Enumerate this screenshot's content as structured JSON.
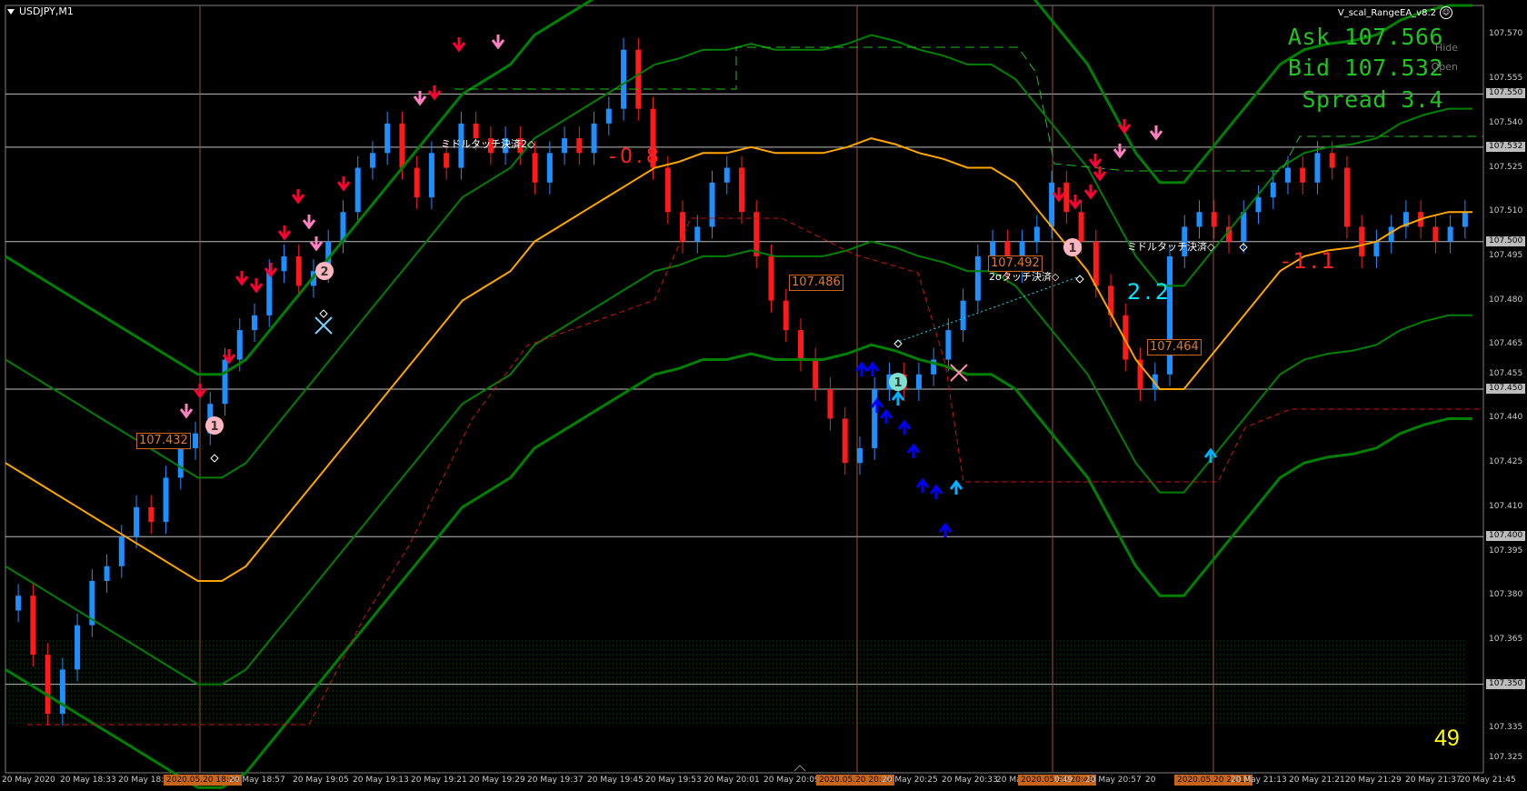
{
  "window": {
    "symbol": "USDJPY,M1",
    "ea_name": "V_scal_RangeEA_v8.2",
    "ea_icon": "smiley-face-icon"
  },
  "quote_panel": {
    "ask": "Ask 107.566",
    "bid": "Bid 107.532",
    "spread": "Spread 3.4",
    "hide_label": "Hide",
    "open_label": "Open",
    "text_color": "#1fc41f"
  },
  "tick_counter": "49",
  "price_axis": {
    "min": 107.32,
    "max": 107.58,
    "labels": [
      "107.570",
      "107.555",
      "107.540",
      "107.525",
      "107.510",
      "107.495",
      "107.480",
      "107.465",
      "107.455",
      "107.440",
      "107.425",
      "107.410",
      "107.395",
      "107.380",
      "107.365",
      "107.335",
      "107.325"
    ],
    "highlighted": [
      "107.550",
      "107.532",
      "107.500",
      "107.450",
      "107.400",
      "107.350"
    ]
  },
  "time_axis": {
    "labels": [
      "20 May 2020",
      "20 May 18:33",
      "20 May 18:",
      "2020.05.20 18:53",
      "20 May 18:57",
      "20 May 19:05",
      "20 May 19:13",
      "20 May 19:21",
      "20 May 19:29",
      "20 May 19:37",
      "20 May 19:45",
      "20 May 19:53",
      "20 May 20:01",
      "20 May 20:09",
      "2020.05.20 20:22",
      "20 May 20:25",
      "20 May 20:33",
      "20 May 20 Ma",
      "2020.05.20 20:49",
      "0:49",
      "20 May 20:57",
      "20",
      "2020.05.20 21:11",
      "20 May 21:13",
      "20 May 21:21",
      "20 May 21:29",
      "20 May 21:37",
      "20 May 21:45"
    ],
    "highlighted": [
      "2020.05.20 18:53",
      "2020.05.20 20:22",
      "2020.05.20 20:49",
      "2020.05.20 21:11"
    ]
  },
  "annotations": {
    "midtouch_1": "ミドルタッチ決済2◇",
    "midtouch_2": "ミドルタッチ決済◇",
    "sigma_touch": "2σタッチ決済◇",
    "price_box_1": "107.432",
    "price_box_2": "107.486",
    "price_box_3": "107.492",
    "price_box_4": "107.464",
    "profit_1": "2.2",
    "profit_2": "-1.1",
    "profit_3": "-0.8",
    "marker_1": "1",
    "marker_2": "2",
    "marker_3": "1",
    "marker_4": "1"
  },
  "colors": {
    "bull_candle": "#1e8fff",
    "bear_candle": "#ff1a1a",
    "middle_band": "#ffa500",
    "bollinger": "#008000",
    "sell_arrow": "#ff0033",
    "sell_arrow_light": "#ff80c0",
    "buy_arrow": "#0000ff",
    "buy_arrow_light": "#00b0ff",
    "vline": "#a0522d",
    "hline": "#bdbdbd"
  },
  "chart_data": {
    "type": "candlestick",
    "symbol": "USDJPY",
    "timeframe": "M1",
    "ylim": [
      107.32,
      107.58
    ],
    "hlines": [
      107.55,
      107.532,
      107.5,
      107.45,
      107.4,
      107.35
    ],
    "vline_times": [
      "18:53",
      "20:22",
      "20:49",
      "21:11"
    ],
    "close_path": [
      107.38,
      107.36,
      107.34,
      107.355,
      107.37,
      107.385,
      107.39,
      107.4,
      107.41,
      107.405,
      107.42,
      107.43,
      107.435,
      107.445,
      107.46,
      107.47,
      107.475,
      107.49,
      107.495,
      107.485,
      107.49,
      107.5,
      107.51,
      107.525,
      107.53,
      107.54,
      107.525,
      107.515,
      107.53,
      107.525,
      107.54,
      107.535,
      107.53,
      107.535,
      107.53,
      107.52,
      107.53,
      107.535,
      107.53,
      107.54,
      107.545,
      107.565,
      107.545,
      107.525,
      107.51,
      107.5,
      107.505,
      107.52,
      107.525,
      107.51,
      107.495,
      107.48,
      107.47,
      107.46,
      107.45,
      107.44,
      107.425,
      107.43,
      107.45,
      107.455,
      107.45,
      107.455,
      107.46,
      107.47,
      107.48,
      107.495,
      107.5,
      107.49,
      107.5,
      107.505,
      107.52,
      107.51,
      107.5,
      107.485,
      107.475,
      107.46,
      107.45,
      107.455,
      107.495,
      107.505,
      107.51,
      107.505,
      107.5,
      107.51,
      107.515,
      107.52,
      107.525,
      107.52,
      107.53,
      107.525,
      107.505,
      107.495,
      107.5,
      107.505,
      107.51,
      107.505,
      107.5,
      107.505,
      107.51
    ],
    "middle_band": [
      107.425,
      107.42,
      107.415,
      107.41,
      107.405,
      107.4,
      107.395,
      107.39,
      107.385,
      107.385,
      107.39,
      107.4,
      107.41,
      107.42,
      107.43,
      107.44,
      107.45,
      107.46,
      107.47,
      107.48,
      107.485,
      107.49,
      107.5,
      107.505,
      107.51,
      107.515,
      107.52,
      107.525,
      107.527,
      107.53,
      107.53,
      107.532,
      107.53,
      107.53,
      107.53,
      107.532,
      107.535,
      107.533,
      107.53,
      107.528,
      107.525,
      107.525,
      107.52,
      107.51,
      107.5,
      107.49,
      107.475,
      107.46,
      107.45,
      107.45,
      107.46,
      107.47,
      107.48,
      107.49,
      107.495,
      107.497,
      107.498,
      107.5,
      107.505,
      107.508,
      107.51,
      107.51
    ]
  }
}
